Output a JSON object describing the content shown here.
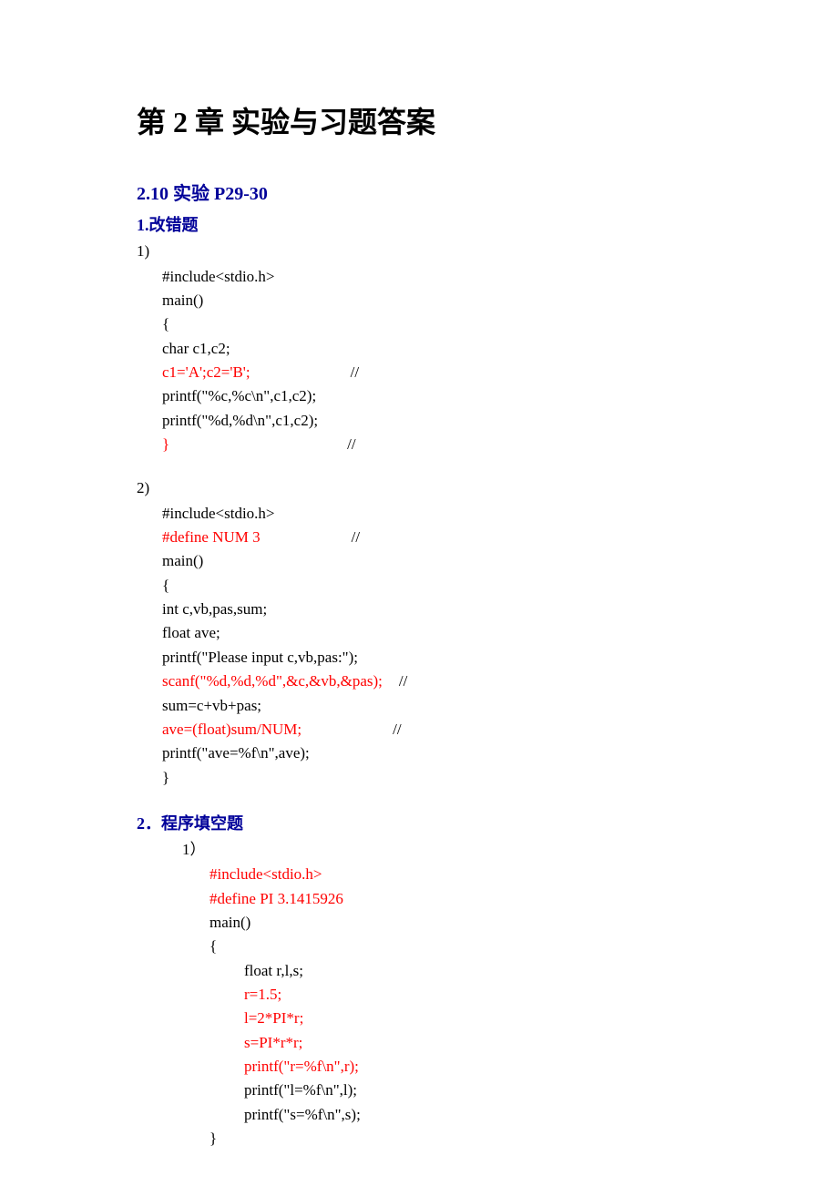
{
  "chapter_title": "第 2 章  实验与习题答案",
  "section_title": "2.10 实验 P29-30",
  "sub1_title": "1.改错题",
  "item1_num": "1)",
  "code1": {
    "l1": "#include<stdio.h>",
    "l2": "main()",
    "l3": "{",
    "l4": "char c1,c2;",
    "l5a": "c1='A';c2='B';",
    "l5b": "//",
    "l6": "printf(\"%c,%c\\n\",c1,c2);",
    "l7": "printf(\"%d,%d\\n\",c1,c2);",
    "l8a": "}",
    "l8b": "//"
  },
  "item2_num": "2)",
  "code2": {
    "l1": "#include<stdio.h>",
    "l2a": "#define NUM 3",
    "l2b": "//",
    "l3": "main()",
    "l4": "{",
    "l5": "int c,vb,pas,sum;",
    "l6": "float ave;",
    "l7": "printf(\"Please input c,vb,pas:\");",
    "l8a": "scanf(\"%d,%d,%d\",&c,&vb,&pas);",
    "l8b": "//",
    "l9": "sum=c+vb+pas;",
    "l10a": "ave=(float)sum/NUM;",
    "l10b": "//",
    "l11": "printf(\"ave=%f\\n\",ave);",
    "l12": "}"
  },
  "sub2_title": "2．程序填空题",
  "item3_num": "1）",
  "code3": {
    "l1": "#include<stdio.h>",
    "l2": "#define PI 3.1415926",
    "l3": "main()",
    "l4": "{",
    "l5": "float r,l,s;",
    "l6": "r=1.5;",
    "l7": "l=2*PI*r;",
    "l8": "s=PI*r*r;",
    "l9": "printf(\"r=%f\\n\",r);",
    "l10": "printf(\"l=%f\\n\",l);",
    "l11": "printf(\"s=%f\\n\",s);",
    "l12": "}"
  }
}
